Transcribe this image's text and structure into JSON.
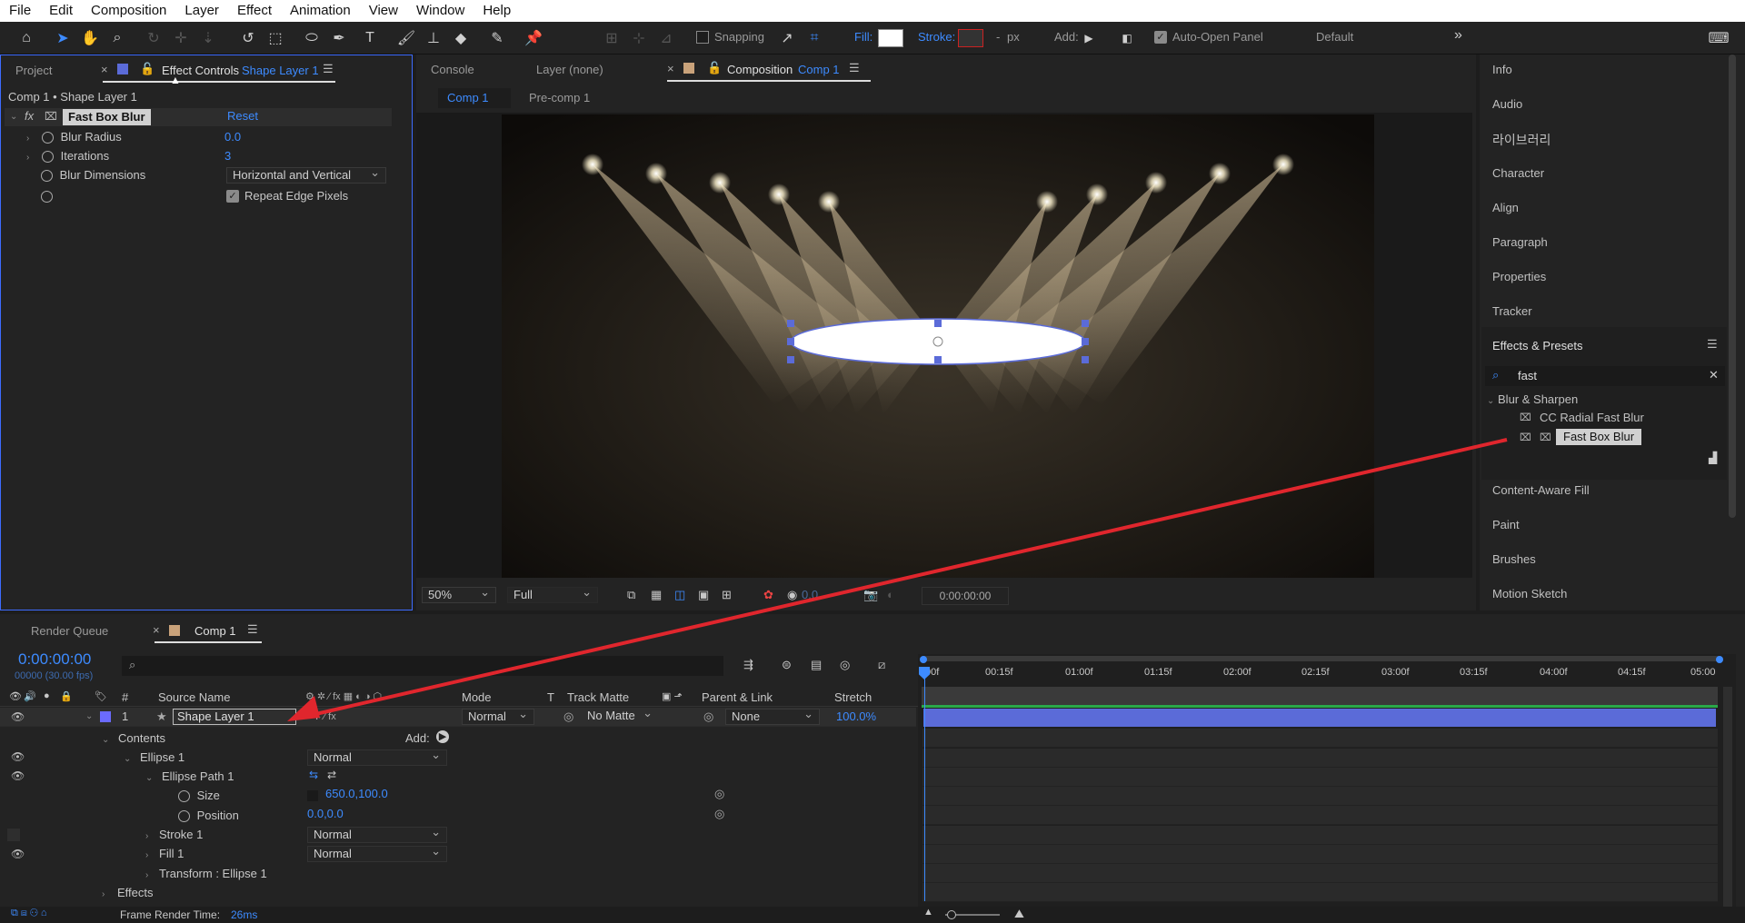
{
  "menu": [
    "File",
    "Edit",
    "Composition",
    "Layer",
    "Effect",
    "Animation",
    "View",
    "Window",
    "Help"
  ],
  "toolbar": {
    "snapping": "Snapping",
    "fill": "Fill:",
    "stroke": "Stroke:",
    "dash": "-",
    "px": "px",
    "add": "Add:",
    "auto_open": "Auto-Open Panel",
    "workspace": "Default",
    "overflow": "»"
  },
  "effect_panel": {
    "tab_project": "Project",
    "tab_effect": "Effect Controls",
    "tab_effect_layer": "Shape Layer 1",
    "header": "Comp 1 • Shape Layer 1",
    "effect_name": "Fast Box Blur",
    "reset": "Reset",
    "props": [
      {
        "name": "Blur Radius",
        "value": "0.0"
      },
      {
        "name": "Iterations",
        "value": "3"
      },
      {
        "name": "Blur Dimensions",
        "value": "Horizontal and Vertical"
      }
    ],
    "repeat_edge": "Repeat Edge Pixels"
  },
  "comp_panel": {
    "tab_console": "Console",
    "tab_layer": "Layer (none)",
    "tab_comp": "Composition",
    "tab_comp_name": "Comp 1",
    "crumb1": "Comp 1",
    "crumb2": "Pre-comp 1",
    "zoom": "50%",
    "resolution": "Full",
    "exposure": "0.0",
    "timecode": "0:00:00:00"
  },
  "right_panel": {
    "items": [
      "Info",
      "Audio",
      "라이브러리",
      "Character",
      "Align",
      "Paragraph",
      "Properties",
      "Tracker"
    ],
    "effects_presets": "Effects & Presets",
    "search_value": "fast",
    "category": "Blur & Sharpen",
    "results": [
      "CC Radial Fast Blur",
      "Fast Box Blur"
    ],
    "items2": [
      "Content-Aware Fill",
      "Paint",
      "Brushes",
      "Motion Sketch"
    ]
  },
  "timeline": {
    "tab_render": "Render Queue",
    "tab_comp": "Comp 1",
    "timecode": "0:00:00:00",
    "fps": "00000 (30.00 fps)",
    "col_num": "#",
    "col_source": "Source Name",
    "col_mode": "Mode",
    "col_t": "T",
    "col_track": "Track Matte",
    "col_parent": "Parent & Link",
    "col_stretch": "Stretch",
    "layer_num": "1",
    "layer_name": "Shape Layer 1",
    "layer_mode": "Normal",
    "layer_matte": "No Matte",
    "layer_parent": "None",
    "layer_stretch": "100.0%",
    "contents": "Contents",
    "add": "Add:",
    "ellipse": "Ellipse 1",
    "ellipse_mode": "Normal",
    "ellipse_path": "Ellipse Path 1",
    "size_label": "Size",
    "size_value": "650.0,100.0",
    "position_label": "Position",
    "position_value": "0.0,0.0",
    "stroke": "Stroke 1",
    "stroke_mode": "Normal",
    "fill": "Fill 1",
    "fill_mode": "Normal",
    "transform": "Transform : Ellipse 1",
    "effects": "Effects",
    "ruler": [
      "00f",
      "00:15f",
      "01:00f",
      "01:15f",
      "02:00f",
      "02:15f",
      "03:00f",
      "03:15f",
      "04:00f",
      "04:15f",
      "05:00"
    ],
    "render_time_label": "Frame Render Time:",
    "render_time_value": "26ms"
  },
  "colors": {
    "accent": "#3d8bff",
    "arrow": "#e0262d",
    "layer_bar": "#5b6bd8",
    "label_purple": "#6b6bff"
  }
}
